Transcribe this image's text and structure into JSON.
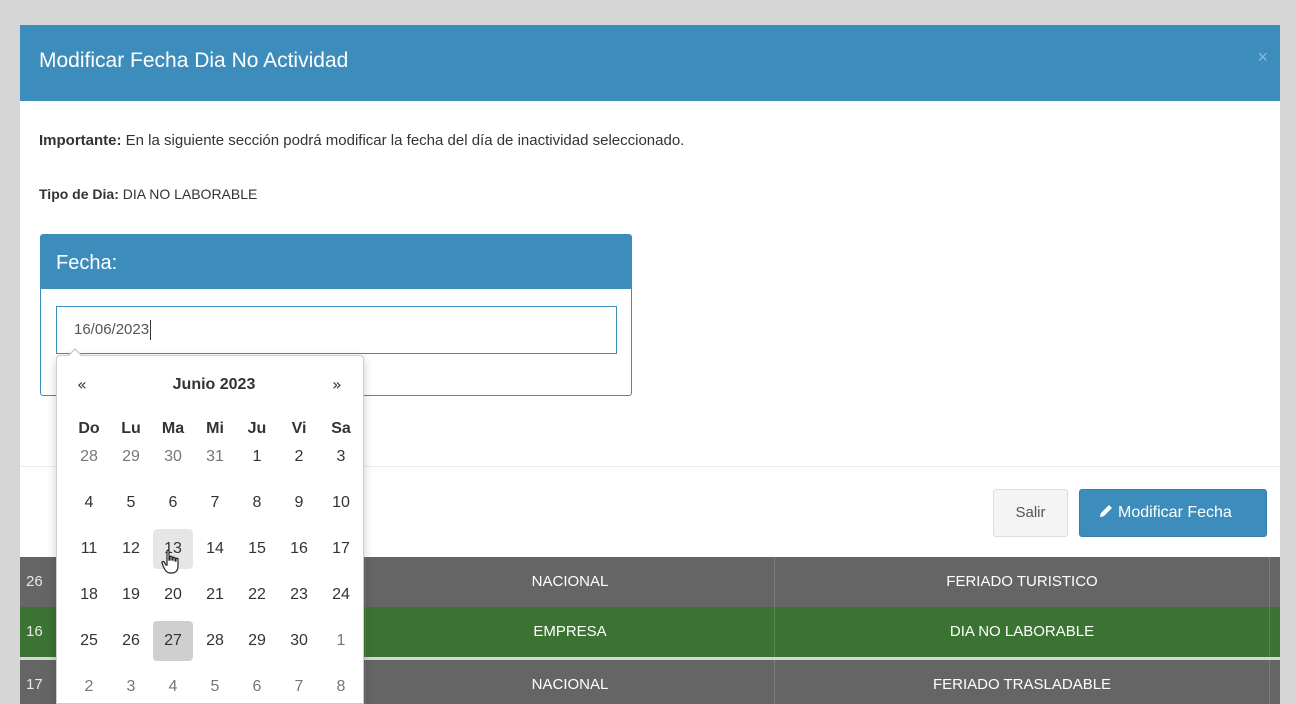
{
  "background_table": {
    "rows": [
      {
        "col1": "26",
        "col2": "NACIONAL",
        "col3": "FERIADO TURISTICO",
        "color": "#656565"
      },
      {
        "col1": "16",
        "col2": "EMPRESA",
        "col3": "DIA NO LABORABLE",
        "color": "#3b7432"
      },
      {
        "col1": "17",
        "col2": "NACIONAL",
        "col3": "FERIADO TRASLADABLE",
        "color": "#656565"
      }
    ]
  },
  "modal": {
    "title": "Modificar Fecha Dia No Actividad",
    "close_label": "×",
    "important_label": "Importante:",
    "important_text": " En la siguiente sección podrá modificar la fecha del día de inactividad seleccionado.",
    "tipo_label": "Tipo de Dia:",
    "tipo_value": " DIA NO LABORABLE",
    "fecha_label": "Fecha:",
    "fecha_value": "16/06/2023",
    "salir_label": "Salir",
    "modificar_label": "Modificar Fecha",
    "accent_color": "#3c8dbc"
  },
  "datepicker": {
    "prev_label": "«",
    "next_label": "»",
    "month_title": "Junio 2023",
    "weekdays": [
      "Do",
      "Lu",
      "Ma",
      "Mi",
      "Ju",
      "Vi",
      "Sa"
    ],
    "weeks": [
      [
        {
          "d": "28",
          "m": true
        },
        {
          "d": "29",
          "m": true
        },
        {
          "d": "30",
          "m": true
        },
        {
          "d": "31",
          "m": true
        },
        {
          "d": "1"
        },
        {
          "d": "2"
        },
        {
          "d": "3"
        }
      ],
      [
        {
          "d": "4"
        },
        {
          "d": "5"
        },
        {
          "d": "6"
        },
        {
          "d": "7"
        },
        {
          "d": "8"
        },
        {
          "d": "9"
        },
        {
          "d": "10"
        }
      ],
      [
        {
          "d": "11"
        },
        {
          "d": "12"
        },
        {
          "d": "13",
          "hover": true
        },
        {
          "d": "14"
        },
        {
          "d": "15"
        },
        {
          "d": "16"
        },
        {
          "d": "17"
        }
      ],
      [
        {
          "d": "18"
        },
        {
          "d": "19"
        },
        {
          "d": "20"
        },
        {
          "d": "21"
        },
        {
          "d": "22"
        },
        {
          "d": "23"
        },
        {
          "d": "24"
        }
      ],
      [
        {
          "d": "25"
        },
        {
          "d": "26"
        },
        {
          "d": "27",
          "active": true
        },
        {
          "d": "28"
        },
        {
          "d": "29"
        },
        {
          "d": "30"
        },
        {
          "d": "1",
          "m": true
        }
      ],
      [
        {
          "d": "2",
          "m": true
        },
        {
          "d": "3",
          "m": true
        },
        {
          "d": "4",
          "m": true
        },
        {
          "d": "5",
          "m": true
        },
        {
          "d": "6",
          "m": true
        },
        {
          "d": "7",
          "m": true
        },
        {
          "d": "8",
          "m": true
        }
      ]
    ]
  }
}
